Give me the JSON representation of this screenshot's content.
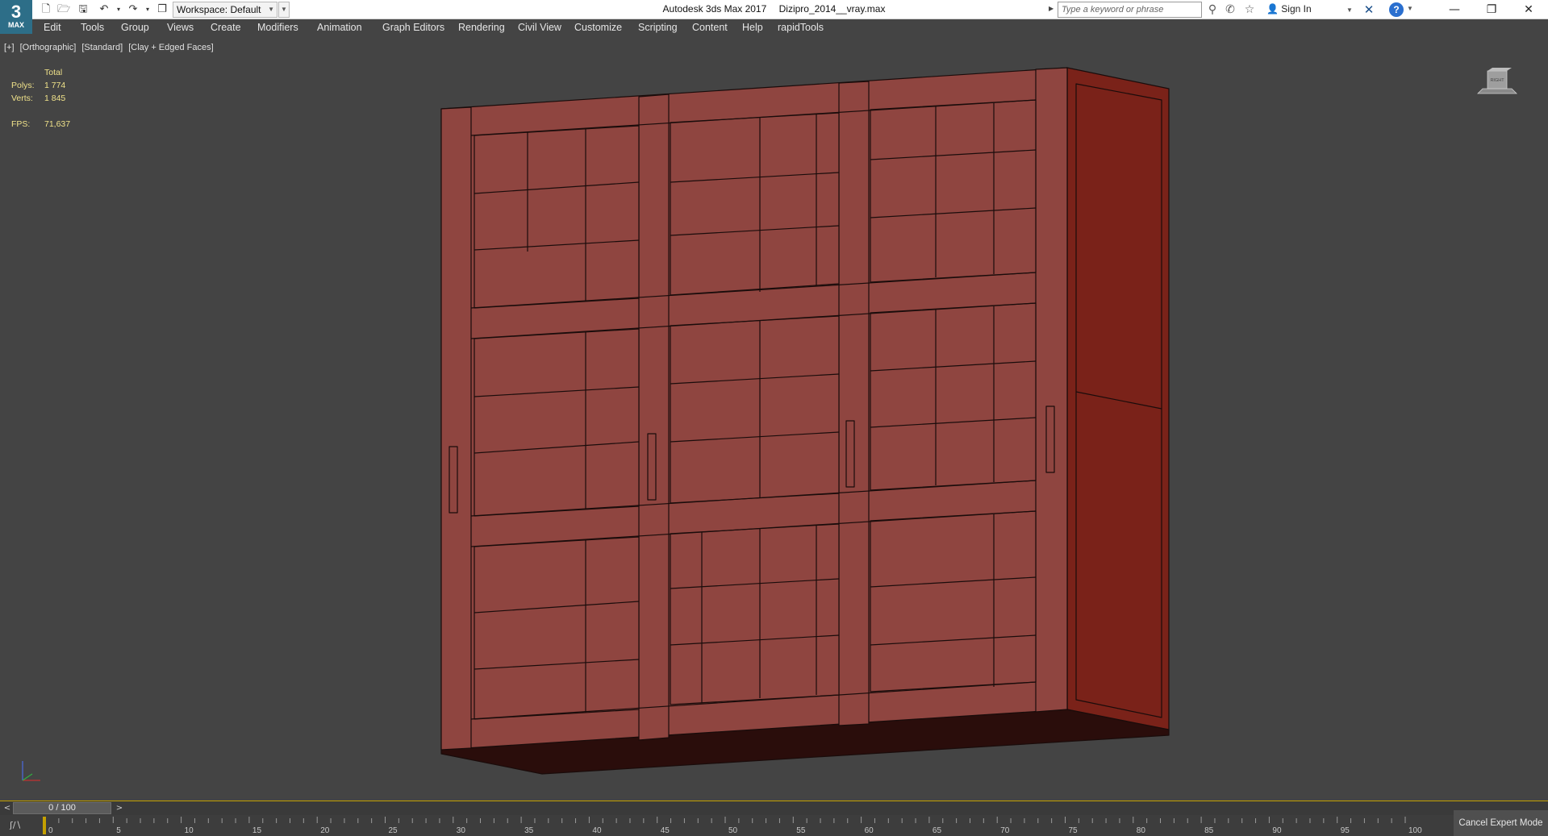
{
  "app": {
    "logo_number": "3",
    "logo_text": "MAX"
  },
  "titlebar": {
    "app_title": "Autodesk 3ds Max 2017",
    "file_name": "Dizipro_2014__vray.max",
    "workspace": "Workspace: Default",
    "search_placeholder": "Type a keyword or phrase",
    "sign_in": "Sign In"
  },
  "menu": [
    "Edit",
    "Tools",
    "Group",
    "Views",
    "Create",
    "Modifiers",
    "Animation",
    "Graph Editors",
    "Rendering",
    "Civil View",
    "Customize",
    "Scripting",
    "Content",
    "Help",
    "rapidTools"
  ],
  "viewport": {
    "labels": [
      "[+]",
      "[Orthographic]",
      "[Standard]",
      "[Clay + Edged Faces]"
    ],
    "stats": {
      "header": "Total",
      "polys_label": "Polys:",
      "polys_value": "1 774",
      "verts_label": "Verts:",
      "verts_value": "1 845",
      "fps_label": "FPS:",
      "fps_value": "71,637"
    },
    "viewcube_label": "RIGHT",
    "model_color": "#8f4540"
  },
  "timeline": {
    "frame_display": "0 / 100",
    "prev_label": "<",
    "next_label": ">",
    "ticks": [
      "0",
      "5",
      "10",
      "15",
      "20",
      "25",
      "30",
      "35",
      "40",
      "45",
      "50",
      "55",
      "60",
      "65",
      "70",
      "75",
      "80",
      "85",
      "90",
      "95",
      "100"
    ],
    "cancel_expert": "Cancel Expert Mode"
  },
  "colors": {
    "accent": "#c4a000",
    "viewport_bg": "#444444",
    "stats": "#f0e28a"
  }
}
